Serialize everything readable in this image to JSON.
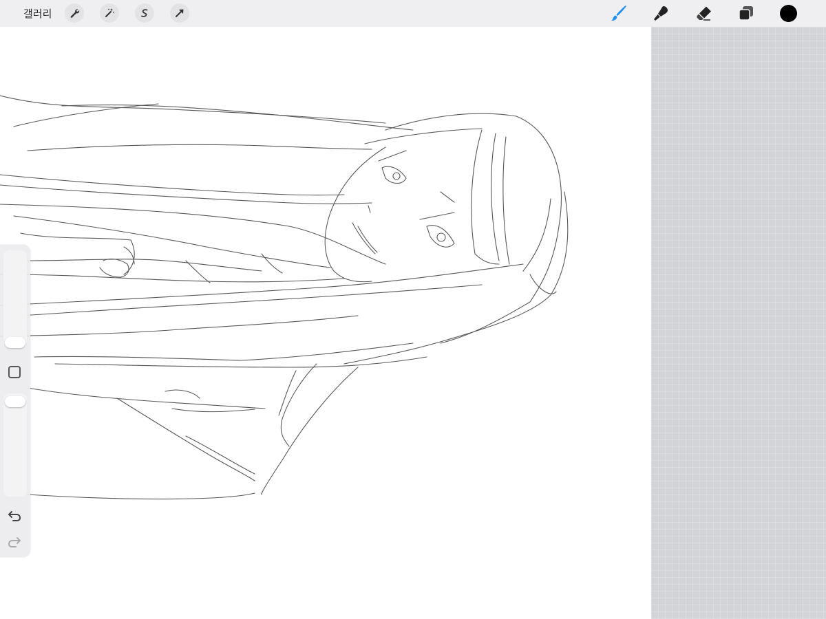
{
  "topbar": {
    "gallery_label": "갤러리",
    "left_tools": [
      "wrench-icon",
      "magic-wand-icon",
      "selection-icon",
      "arrow-icon"
    ],
    "right_tools": [
      "brush-icon",
      "smudge-icon",
      "eraser-icon",
      "layers-icon"
    ],
    "active_tool": "brush-icon",
    "accent_color": "#1e8ef0",
    "current_color": "#000000"
  },
  "sidebar": {
    "brush_size_level": 0.0,
    "opacity_level": 1.0,
    "icons": [
      "modify-square-icon",
      "undo-icon",
      "redo-icon"
    ]
  },
  "canvas": {
    "background": "#ffffff",
    "content": "pencil-sketch"
  }
}
